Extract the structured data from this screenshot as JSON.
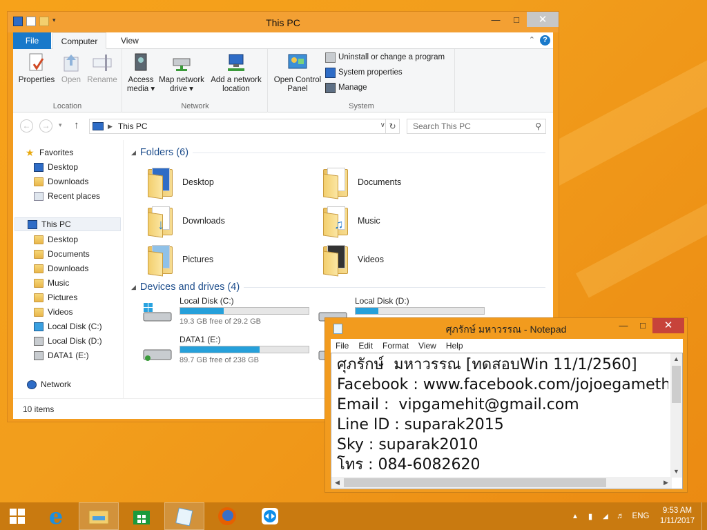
{
  "explorer": {
    "title": "This PC",
    "tabs": {
      "file": "File",
      "computer": "Computer",
      "view": "View"
    },
    "ribbon": {
      "location": {
        "label": "Location",
        "properties": "Properties",
        "open": "Open",
        "rename": "Rename"
      },
      "network": {
        "label": "Network",
        "access_media_1": "Access",
        "access_media_2": "media ▾",
        "map_drive_1": "Map network",
        "map_drive_2": "drive ▾",
        "add_location_1": "Add a network",
        "add_location_2": "location"
      },
      "system": {
        "label": "System",
        "open_cp_1": "Open Control",
        "open_cp_2": "Panel",
        "uninstall": "Uninstall or change a program",
        "sysprops": "System properties",
        "manage": "Manage"
      }
    },
    "address": {
      "path": "This PC",
      "search_placeholder": "Search This PC"
    },
    "nav": {
      "favorites": "Favorites",
      "fav_desktop": "Desktop",
      "fav_downloads": "Downloads",
      "fav_recent": "Recent places",
      "this_pc": "This PC",
      "pc_desktop": "Desktop",
      "pc_documents": "Documents",
      "pc_downloads": "Downloads",
      "pc_music": "Music",
      "pc_pictures": "Pictures",
      "pc_videos": "Videos",
      "pc_c": "Local Disk (C:)",
      "pc_d": "Local Disk (D:)",
      "pc_e": "DATA1 (E:)",
      "network": "Network"
    },
    "folders_header": "Folders (6)",
    "folders": [
      "Desktop",
      "Documents",
      "Downloads",
      "Music",
      "Pictures",
      "Videos"
    ],
    "devices_header": "Devices and drives (4)",
    "drives": [
      {
        "name": "Local Disk (C:)",
        "free": "19.3 GB free of 29.2 GB",
        "used_pct": 34
      },
      {
        "name": "Local Disk (D:)",
        "free": "",
        "used_pct": 18
      },
      {
        "name": "DATA1 (E:)",
        "free": "89.7 GB free of 238 GB",
        "used_pct": 62
      }
    ],
    "status": "10 items"
  },
  "notepad": {
    "title": "ศุภรักษ์  มหาวรรณ - Notepad",
    "menu": {
      "file": "File",
      "edit": "Edit",
      "format": "Format",
      "view": "View",
      "help": "Help"
    },
    "lines": [
      "ศุภรักษ์  มหาวรรณ [ทดสอบWin 11/1/2560]",
      "Facebook : www.facebook.com/jojoegameth",
      "Email :  vipgamehit@gmail.com",
      "Line ID : suparak2015",
      "Sky : suparak2010",
      "โทร : 084-6082620"
    ]
  },
  "taskbar": {
    "lang": "ENG",
    "time": "9:53 AM",
    "date": "1/11/2017"
  }
}
